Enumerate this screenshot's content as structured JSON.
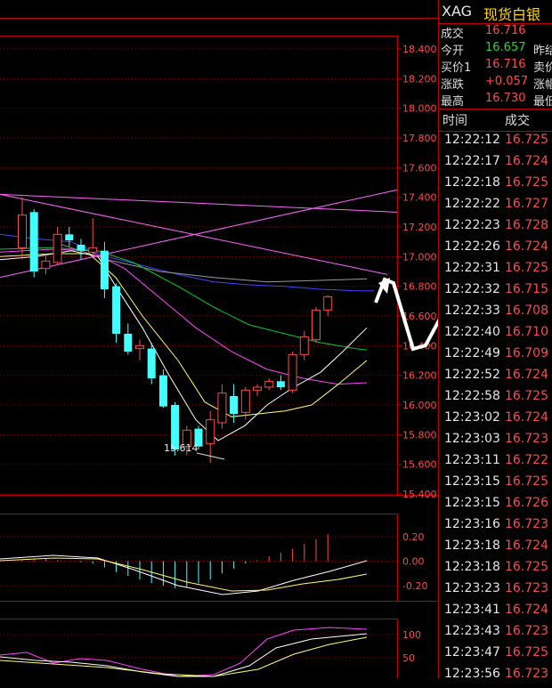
{
  "quote": {
    "code": "XAG",
    "name": "现货白银",
    "rows": [
      {
        "label": "成交",
        "value": "16.716",
        "color": "red",
        "label2": ""
      },
      {
        "label": "今开",
        "value": "16.657",
        "color": "green",
        "label2": "昨结"
      },
      {
        "label": "买价1",
        "value": "16.716",
        "color": "red",
        "label2": "卖价"
      },
      {
        "label": "涨跌",
        "value": "+0.057",
        "color": "red",
        "label2": "涨幅"
      },
      {
        "label": "最高",
        "value": "16.730",
        "color": "red",
        "label2": "最低"
      }
    ]
  },
  "ticks": {
    "time_header": "时间",
    "price_header": "成交",
    "rows": [
      {
        "time": "12:22:12",
        "price": "16.725"
      },
      {
        "time": "12:22:17",
        "price": "16.724"
      },
      {
        "time": "12:22:18",
        "price": "16.725"
      },
      {
        "time": "12:22:22",
        "price": "16.727"
      },
      {
        "time": "12:22:23",
        "price": "16.728"
      },
      {
        "time": "12:22:26",
        "price": "16.724"
      },
      {
        "time": "12:22:31",
        "price": "16.725"
      },
      {
        "time": "12:22:32",
        "price": "16.715"
      },
      {
        "time": "12:22:33",
        "price": "16.708"
      },
      {
        "time": "12:22:40",
        "price": "16.710"
      },
      {
        "time": "12:22:49",
        "price": "16.709"
      },
      {
        "time": "12:22:52",
        "price": "16.724"
      },
      {
        "time": "12:22:58",
        "price": "16.725"
      },
      {
        "time": "12:23:02",
        "price": "16.724"
      },
      {
        "time": "12:23:03",
        "price": "16.723"
      },
      {
        "time": "12:23:11",
        "price": "16.722"
      },
      {
        "time": "12:23:15",
        "price": "16.725"
      },
      {
        "time": "12:23:15",
        "price": "16.726"
      },
      {
        "time": "12:23:16",
        "price": "16.723"
      },
      {
        "time": "12:23:18",
        "price": "16.724"
      },
      {
        "time": "12:23:18",
        "price": "16.725"
      },
      {
        "time": "12:23:23",
        "price": "16.723"
      },
      {
        "time": "12:23:41",
        "price": "16.724"
      },
      {
        "time": "12:23:43",
        "price": "16.723"
      },
      {
        "time": "12:23:47",
        "price": "16.725"
      },
      {
        "time": "12:23:56",
        "price": "16.723"
      }
    ]
  },
  "chart_data": [
    {
      "type": "candlestick",
      "y_ticks": [
        "18.400",
        "18.200",
        "18.000",
        "17.800",
        "17.600",
        "17.400",
        "17.200",
        "17.000",
        "16.800",
        "16.600",
        "16.400",
        "16.200",
        "16.000",
        "15.800",
        "15.600",
        "15.400"
      ],
      "ylim": [
        15.4,
        18.4
      ],
      "annotation": "15.614",
      "colors": {
        "up": "#ff4a4a",
        "down": "#44ffff",
        "ma1": "#ffffff",
        "ma2": "#ffff66",
        "ma3": "#00cc33",
        "ma4": "#ff44ff",
        "ma5": "#4444ff",
        "ma6": "#999999",
        "trend": "#ff66ff"
      },
      "candles": [
        {
          "o": 17.06,
          "h": 17.4,
          "l": 16.98,
          "c": 17.28
        },
        {
          "o": 17.3,
          "h": 17.32,
          "l": 16.86,
          "c": 16.9
        },
        {
          "o": 16.92,
          "h": 17.02,
          "l": 16.88,
          "c": 16.97
        },
        {
          "o": 16.96,
          "h": 17.2,
          "l": 16.94,
          "c": 17.15
        },
        {
          "o": 17.15,
          "h": 17.2,
          "l": 17.07,
          "c": 17.11
        },
        {
          "o": 17.08,
          "h": 17.12,
          "l": 16.98,
          "c": 17.04
        },
        {
          "o": 17.03,
          "h": 17.26,
          "l": 17.01,
          "c": 17.06
        },
        {
          "o": 17.04,
          "h": 17.1,
          "l": 16.72,
          "c": 16.78
        },
        {
          "o": 16.8,
          "h": 16.82,
          "l": 16.42,
          "c": 16.48
        },
        {
          "o": 16.48,
          "h": 16.55,
          "l": 16.34,
          "c": 16.36
        },
        {
          "o": 16.38,
          "h": 16.44,
          "l": 16.3,
          "c": 16.4
        },
        {
          "o": 16.38,
          "h": 16.42,
          "l": 16.14,
          "c": 16.18
        },
        {
          "o": 16.2,
          "h": 16.24,
          "l": 15.98,
          "c": 15.99
        },
        {
          "o": 16.0,
          "h": 16.02,
          "l": 15.66,
          "c": 15.7
        },
        {
          "o": 15.72,
          "h": 15.86,
          "l": 15.66,
          "c": 15.83
        },
        {
          "o": 15.84,
          "h": 15.86,
          "l": 15.7,
          "c": 15.72
        },
        {
          "o": 15.74,
          "h": 15.96,
          "l": 15.61,
          "c": 15.9
        },
        {
          "o": 15.88,
          "h": 16.14,
          "l": 15.84,
          "c": 16.08
        },
        {
          "o": 16.06,
          "h": 16.14,
          "l": 15.88,
          "c": 15.94
        },
        {
          "o": 15.95,
          "h": 16.12,
          "l": 15.9,
          "c": 16.1
        },
        {
          "o": 16.1,
          "h": 16.14,
          "l": 16.06,
          "c": 16.12
        },
        {
          "o": 16.12,
          "h": 16.18,
          "l": 16.1,
          "c": 16.16
        },
        {
          "o": 16.16,
          "h": 16.2,
          "l": 16.1,
          "c": 16.12
        },
        {
          "o": 16.1,
          "h": 16.36,
          "l": 16.08,
          "c": 16.34
        },
        {
          "o": 16.34,
          "h": 16.5,
          "l": 16.3,
          "c": 16.46
        },
        {
          "o": 16.44,
          "h": 16.66,
          "l": 16.42,
          "c": 16.64
        },
        {
          "o": 16.64,
          "h": 16.74,
          "l": 16.6,
          "c": 16.73
        }
      ]
    },
    {
      "type": "bar",
      "y_ticks": [
        "0.20",
        "0.00",
        "-0.20"
      ],
      "ylim": [
        -0.3,
        0.3
      ]
    },
    {
      "type": "line",
      "y_ticks": [
        "100",
        "50"
      ],
      "ylim": [
        0,
        100
      ]
    }
  ]
}
